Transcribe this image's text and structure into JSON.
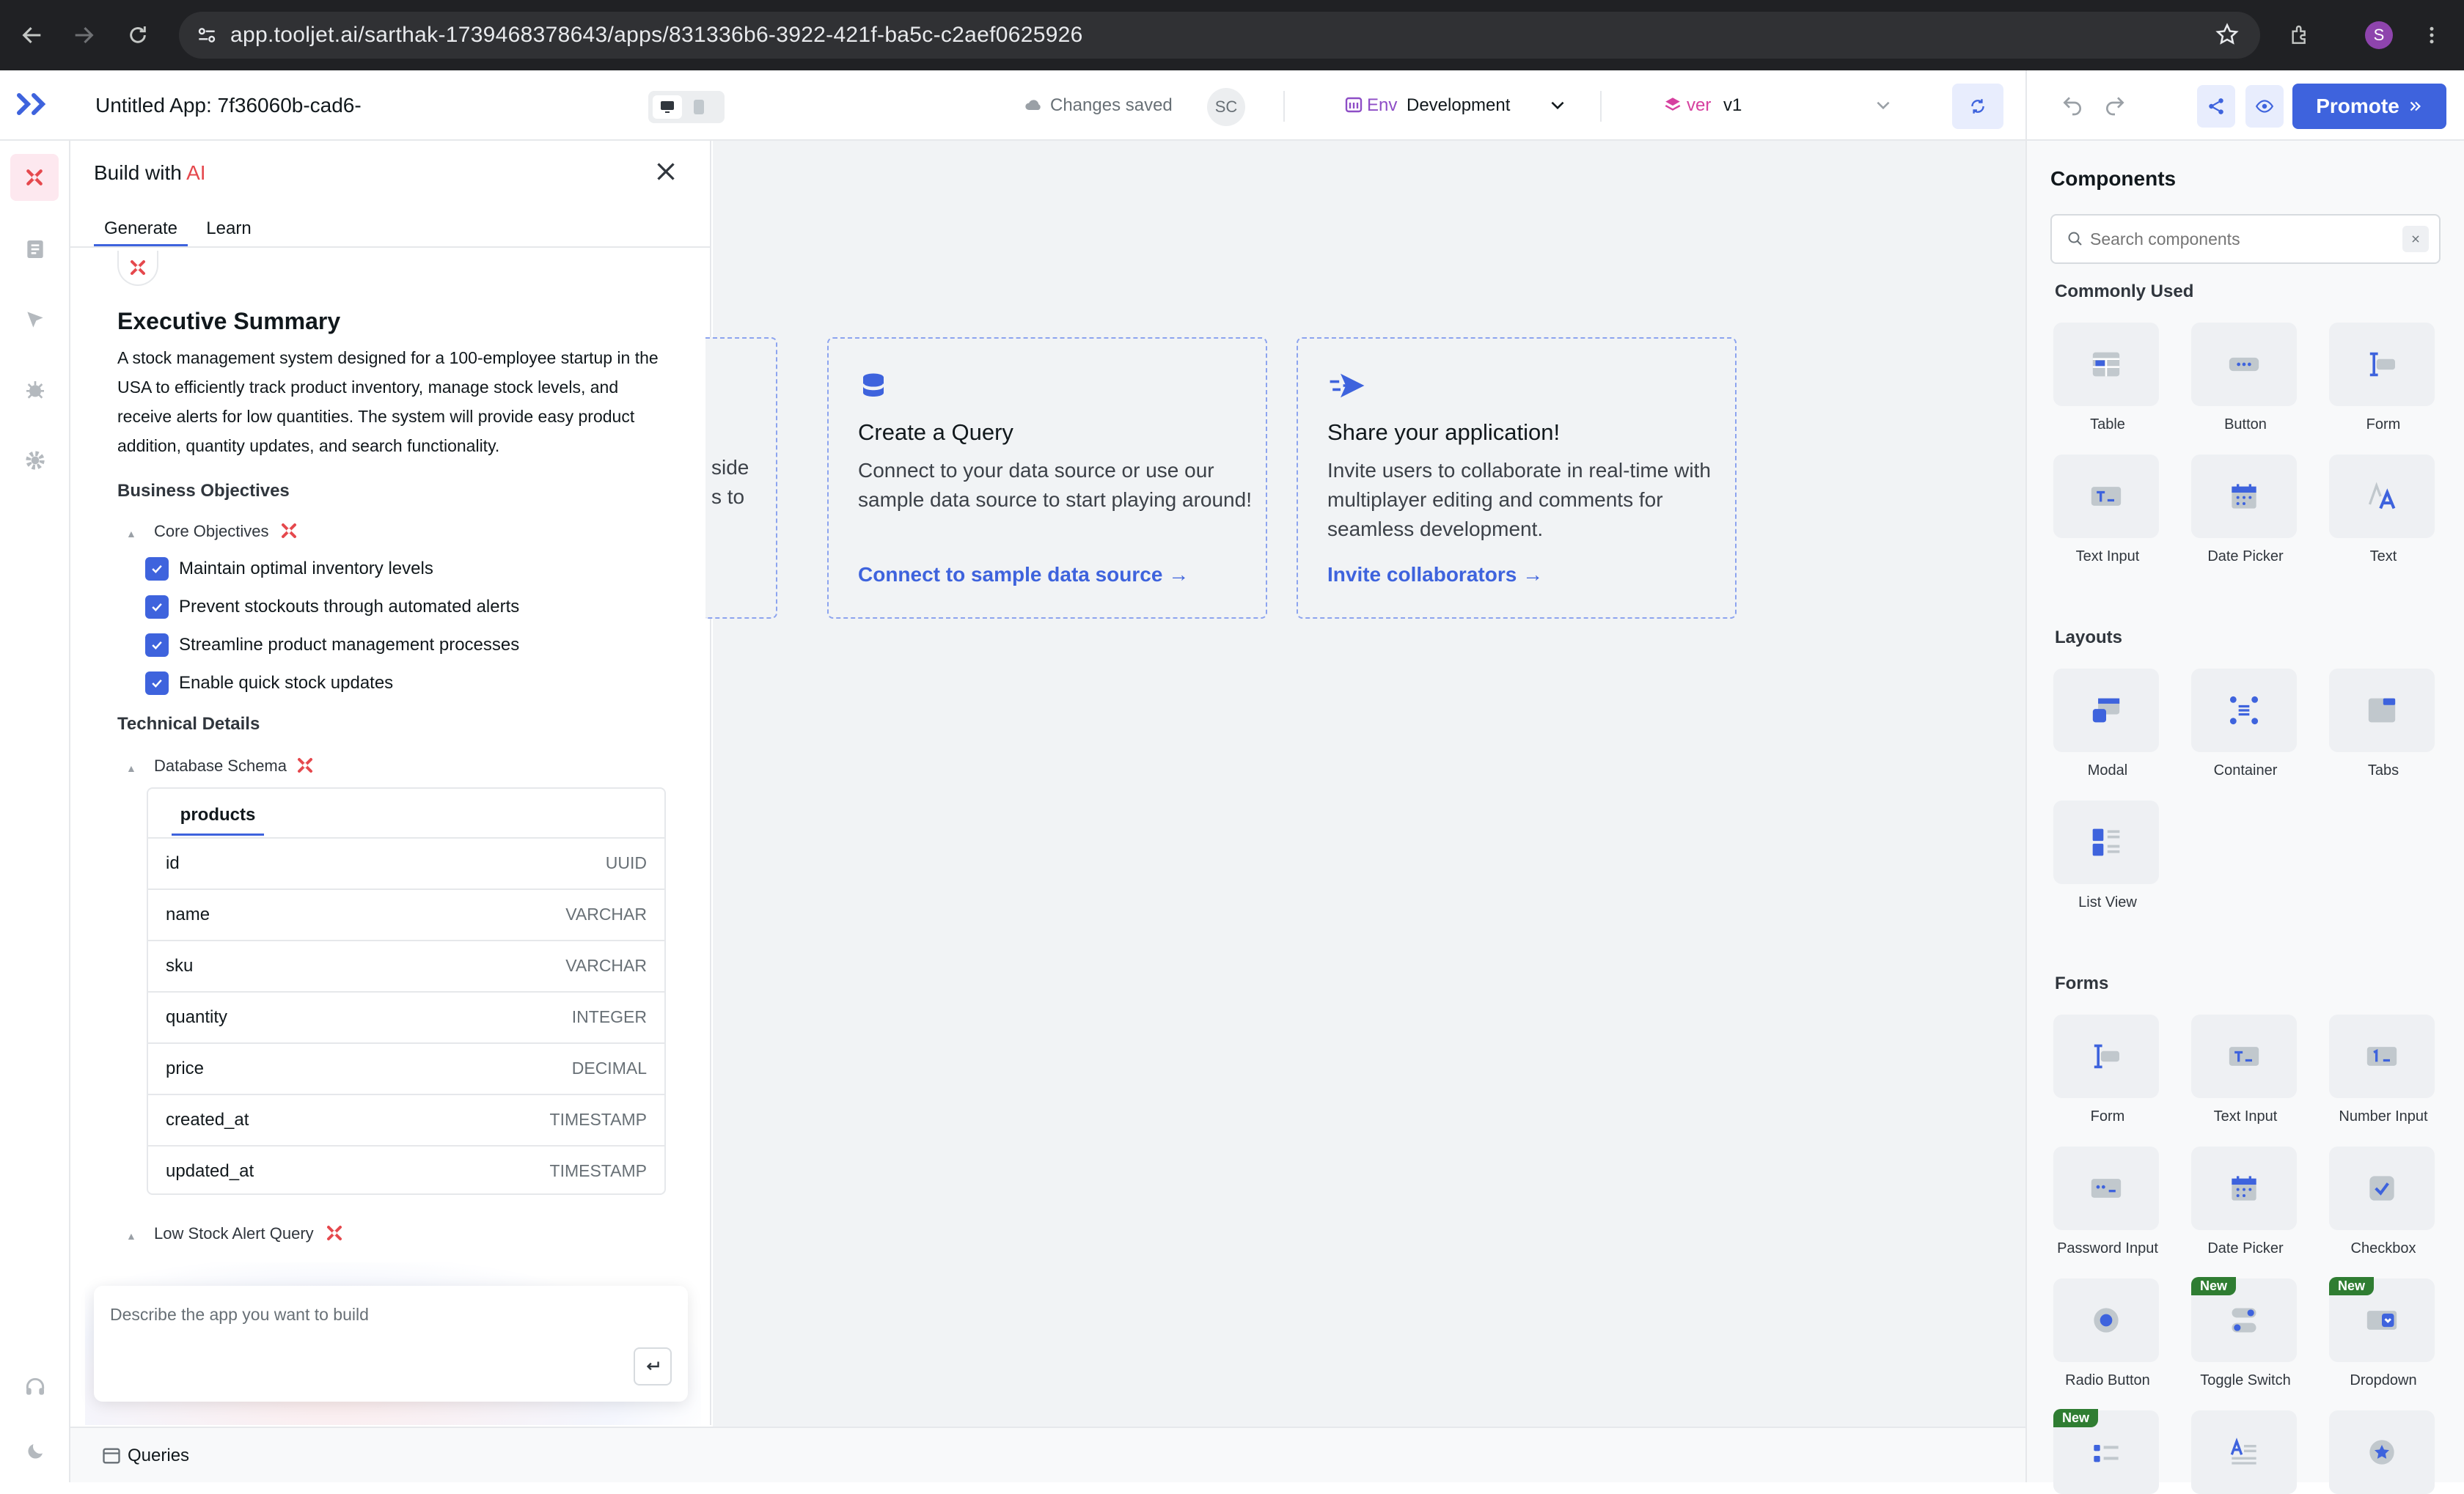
{
  "browser": {
    "url": "app.tooljet.ai/sarthak-1739468378643/apps/831336b6-3922-421f-ba5c-c2aef0625926",
    "profile_initial": "S"
  },
  "appbar": {
    "app_name": "Untitled App: 7f36060b-cad6-",
    "save_status": "Changes saved",
    "avatar_initials": "SC",
    "env_label": "Env",
    "env_value": "Development",
    "ver_label": "ver",
    "ver_value": "v1",
    "promote_label": "Promote"
  },
  "ai_panel": {
    "title_prefix": "Build with ",
    "title_ai": "AI",
    "tabs": [
      "Generate",
      "Learn"
    ],
    "summary_title": "Executive Summary",
    "summary_text": "A stock management system designed for a 100-employee startup in the USA to efficiently track product inventory, manage stock levels, and receive alerts for low quantities. The system will provide easy product addition, quantity updates, and search functionality.",
    "objectives_heading": "Business Objectives",
    "core_objectives_label": "Core Objectives",
    "objectives": [
      "Maintain optimal inventory levels",
      "Prevent stockouts through automated alerts",
      "Streamline product management processes",
      "Enable quick stock updates"
    ],
    "technical_heading": "Technical Details",
    "schema_label": "Database Schema",
    "table_name": "products",
    "columns": [
      {
        "name": "id",
        "type": "UUID"
      },
      {
        "name": "name",
        "type": "VARCHAR"
      },
      {
        "name": "sku",
        "type": "VARCHAR"
      },
      {
        "name": "quantity",
        "type": "INTEGER"
      },
      {
        "name": "price",
        "type": "DECIMAL"
      },
      {
        "name": "created_at",
        "type": "TIMESTAMP"
      },
      {
        "name": "updated_at",
        "type": "TIMESTAMP"
      }
    ],
    "query_label": "Low Stock Alert Query",
    "prompt_placeholder": "Describe the app you want to build"
  },
  "canvas": {
    "partial_card": {
      "line1": "side",
      "line2": "s to"
    },
    "query_card": {
      "title": "Create a Query",
      "text": "Connect to your data source or use our sample data source to start playing around!",
      "link": "Connect to sample data source"
    },
    "share_card": {
      "title": "Share your application!",
      "text": "Invite users to collaborate in real-time with multiplayer editing and comments for seamless development.",
      "link": "Invite collaborators"
    }
  },
  "footer": {
    "queries_label": "Queries"
  },
  "components_panel": {
    "title": "Components",
    "search_placeholder": "Search components",
    "sections": {
      "commonly_used": "Commonly Used",
      "layouts": "Layouts",
      "forms": "Forms"
    },
    "commonly_used": [
      "Table",
      "Button",
      "Form",
      "Text Input",
      "Date Picker",
      "Text"
    ],
    "layouts": [
      "Modal",
      "Container",
      "Tabs",
      "List View"
    ],
    "forms": [
      "Form",
      "Text Input",
      "Number Input",
      "Password Input",
      "Date Picker",
      "Checkbox",
      "Radio Button",
      "Toggle Switch",
      "Dropdown"
    ],
    "new_badge": "New"
  },
  "colors": {
    "accent": "#3e63dd",
    "ai_pink": "#e5484d",
    "canvas_bg": "#f1f3f5"
  }
}
